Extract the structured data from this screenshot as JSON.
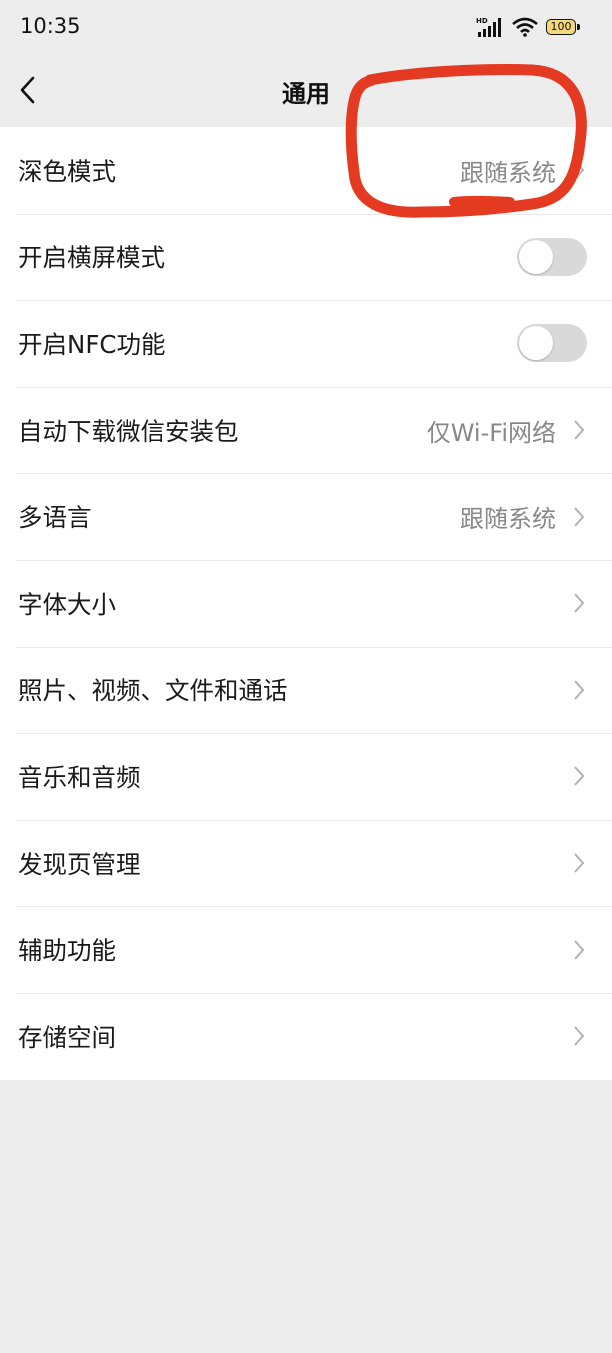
{
  "status_bar": {
    "time": "10:35",
    "network_badge": "HD",
    "battery_level": "100"
  },
  "header": {
    "title": "通用",
    "back_icon": "chevron-left-icon"
  },
  "settings": {
    "dark_mode": {
      "label": "深色模式",
      "value": "跟随系统"
    },
    "landscape": {
      "label": "开启横屏模式",
      "enabled": false
    },
    "nfc": {
      "label": "开启NFC功能",
      "enabled": false
    },
    "auto_download": {
      "label": "自动下载微信安装包",
      "value": "仅Wi-Fi网络"
    },
    "language": {
      "label": "多语言",
      "value": "跟随系统"
    },
    "font_size": {
      "label": "字体大小"
    },
    "media": {
      "label": "照片、视频、文件和通话"
    },
    "music": {
      "label": "音乐和音频"
    },
    "discover": {
      "label": "发现页管理"
    },
    "accessibility": {
      "label": "辅助功能"
    },
    "storage": {
      "label": "存储空间"
    }
  },
  "colors": {
    "background": "#ededed",
    "row_background": "#ffffff",
    "annotation_red": "#e53a22",
    "toggle_off": "#d9d9d9",
    "secondary_text": "#888888"
  }
}
